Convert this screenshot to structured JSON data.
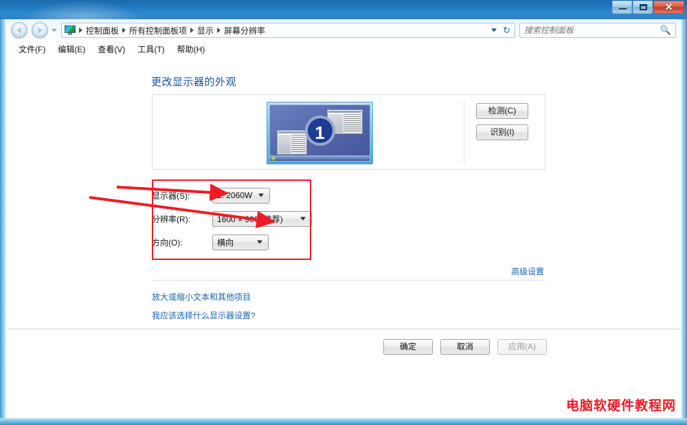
{
  "window": {
    "controls": {
      "minimize": "minimize-button",
      "maximize": "maximize-button",
      "close_glyph": "✕"
    }
  },
  "address_bar": {
    "breadcrumbs": [
      "控制面板",
      "所有控制面板项",
      "显示",
      "屏幕分辨率"
    ],
    "search": {
      "placeholder": "搜索控制面板",
      "value": "",
      "icon": "search-icon"
    },
    "refresh_icon": "↻"
  },
  "menu_bar": {
    "items": [
      "文件(F)",
      "编辑(E)",
      "查看(V)",
      "工具(T)",
      "帮助(H)"
    ]
  },
  "main": {
    "page_title": "更改显示器的外观",
    "preview": {
      "monitor_number": "1"
    },
    "preview_buttons": {
      "detect": "检测(C)",
      "identify": "识别(I)"
    },
    "form": {
      "rows": [
        {
          "label": "显示器(S):",
          "value": "1. 2060W"
        },
        {
          "label": "分辨率(R):",
          "value": "1600 × 900 (推荐)"
        },
        {
          "label": "方向(O):",
          "value": "横向"
        }
      ]
    },
    "links": {
      "advanced": "高级设置",
      "scale_text": "放大或缩小文本和其他项目",
      "which_settings": "我应该选择什么显示器设置?"
    },
    "footer_buttons": {
      "ok": "确定",
      "cancel": "取消",
      "apply": "应用(A)"
    }
  },
  "annotations": {
    "color": "#ee1c25"
  },
  "watermark": {
    "text": "电脑软硬件教程网",
    "color": "#ec1c24"
  }
}
